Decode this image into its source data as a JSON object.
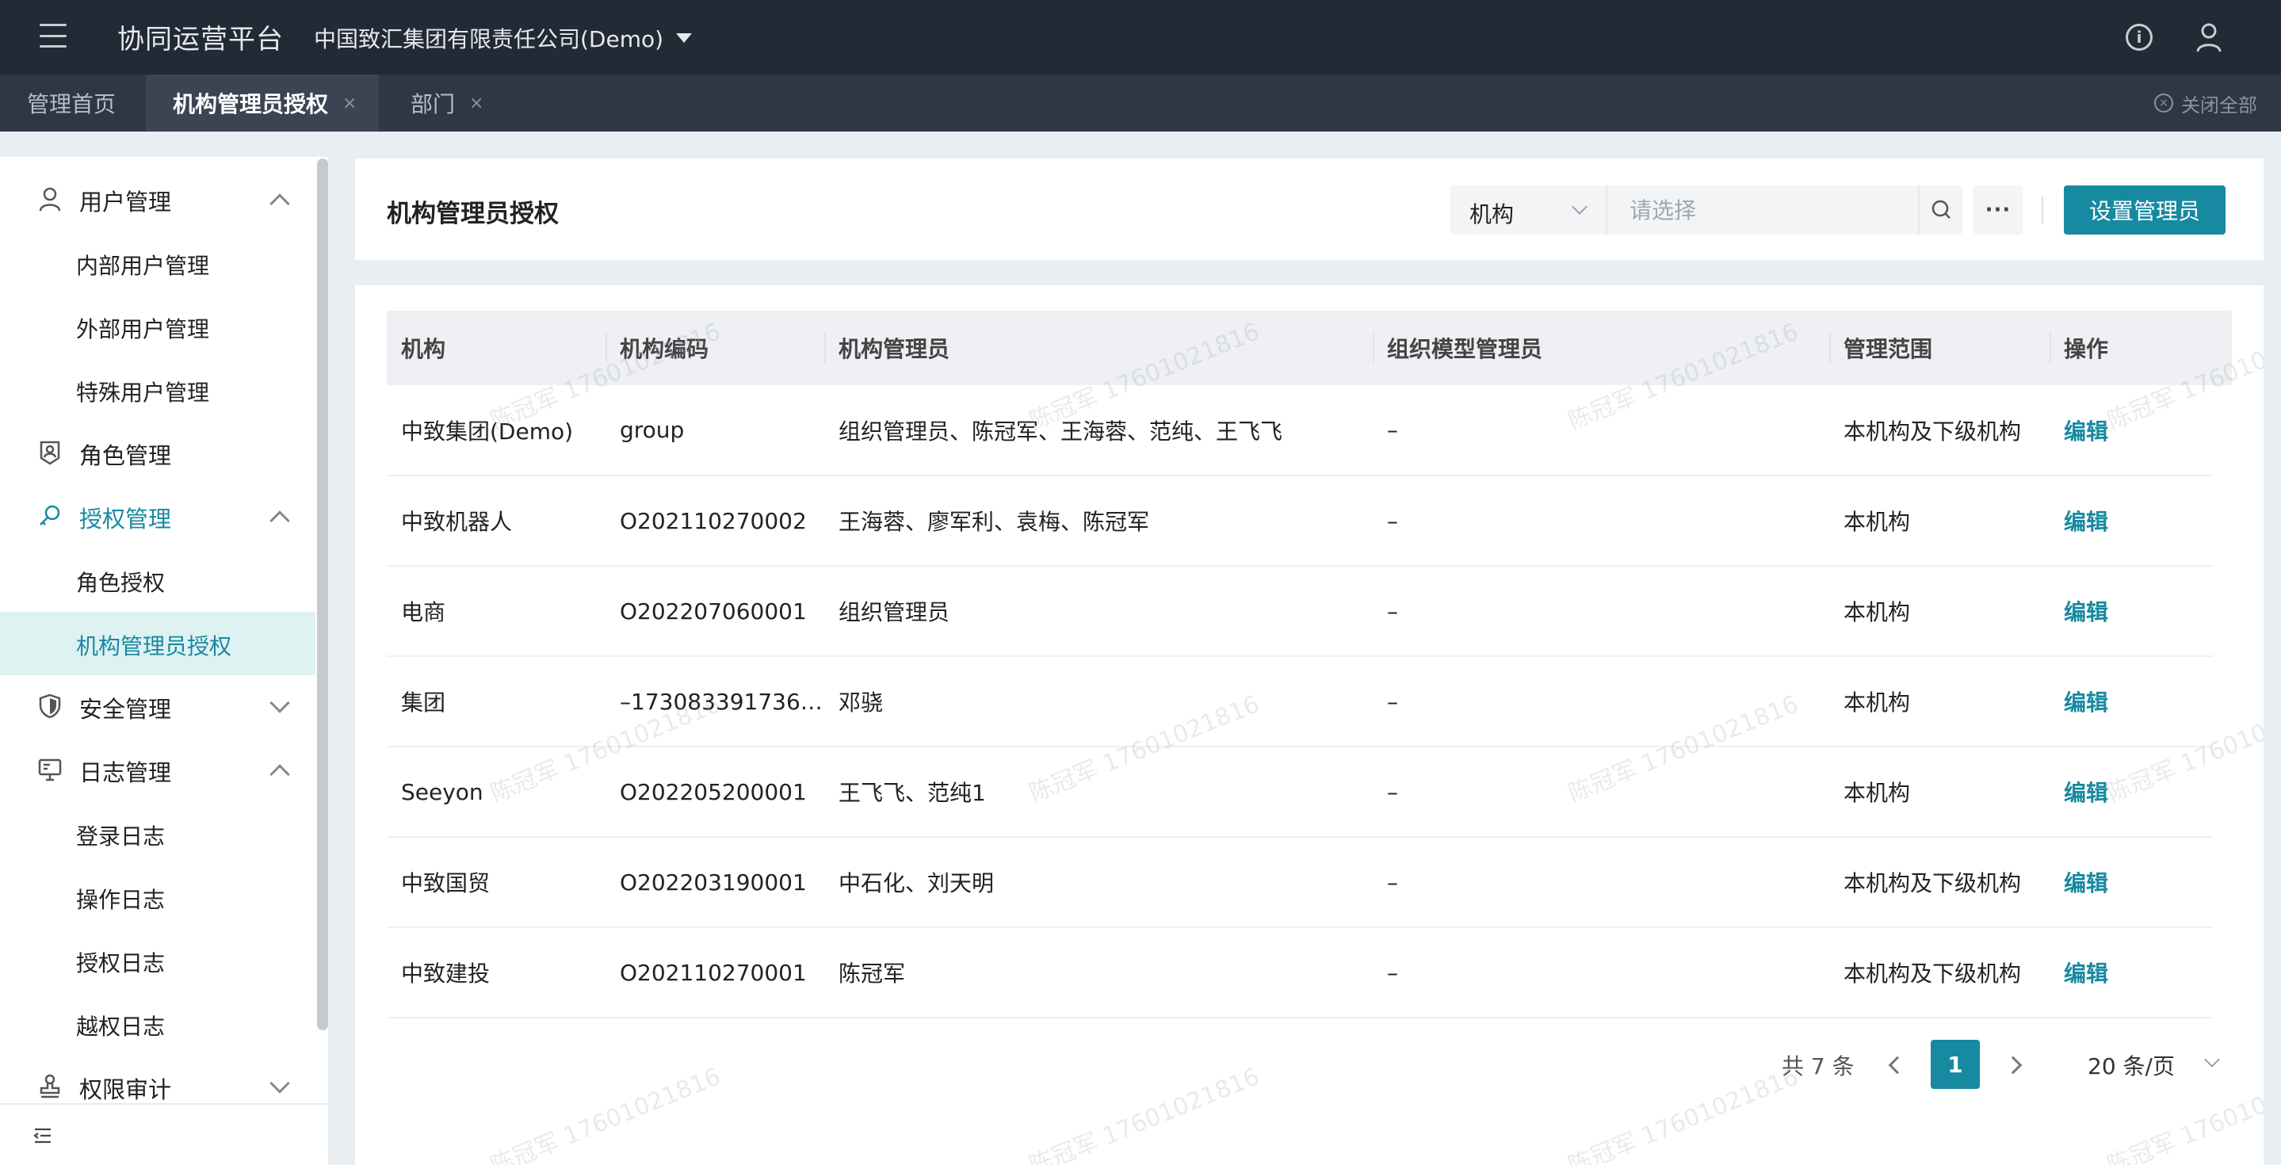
{
  "topbar": {
    "app_title": "协同运营平台",
    "company": "中国致汇集团有限责任公司(Demo)"
  },
  "tabs": [
    {
      "label": "管理首页",
      "active": false,
      "closable": false
    },
    {
      "label": "机构管理员授权",
      "active": true,
      "closable": true
    },
    {
      "label": "部门",
      "active": false,
      "closable": true
    }
  ],
  "tabbar": {
    "close_all": "关闭全部",
    "close_glyph": "×"
  },
  "sidebar": {
    "groups": [
      {
        "label": "用户管理",
        "icon": "user-icon",
        "expanded": true
      },
      {
        "label": "角色管理",
        "icon": "role-icon",
        "expanded": false
      },
      {
        "label": "授权管理",
        "icon": "key-icon",
        "expanded": true,
        "active": true
      },
      {
        "label": "安全管理",
        "icon": "shield-icon",
        "expanded": false
      },
      {
        "label": "日志管理",
        "icon": "monitor-icon",
        "expanded": true
      },
      {
        "label": "权限审计",
        "icon": "stamp-icon",
        "expanded": false
      }
    ],
    "items": {
      "user": [
        "内部用户管理",
        "外部用户管理",
        "特殊用户管理"
      ],
      "auth": [
        "角色授权",
        "机构管理员授权"
      ],
      "log": [
        "登录日志",
        "操作日志",
        "授权日志",
        "越权日志"
      ]
    },
    "selected_item": "机构管理员授权"
  },
  "header": {
    "title": "机构管理员授权",
    "filter_field": "机构",
    "filter_placeholder": "请选择",
    "more_label": "···",
    "primary_button": "设置管理员"
  },
  "table": {
    "columns": [
      "机构",
      "机构编码",
      "机构管理员",
      "组织模型管理员",
      "管理范围",
      "操作"
    ],
    "rows": [
      {
        "org": "中致集团(Demo)",
        "code": "group",
        "admins": "组织管理员、陈冠军、王海蓉、范纯、王飞飞",
        "model_admins": "–",
        "scope": "本机构及下级机构",
        "action": "编辑"
      },
      {
        "org": "中致机器人",
        "code": "O202110270002",
        "admins": "王海蓉、廖军利、袁梅、陈冠军",
        "model_admins": "–",
        "scope": "本机构",
        "action": "编辑"
      },
      {
        "org": "电商",
        "code": "O202207060001",
        "admins": "组织管理员",
        "model_admins": "–",
        "scope": "本机构",
        "action": "编辑"
      },
      {
        "org": "集团",
        "code": "–173083391736…",
        "admins": "邓骁",
        "model_admins": "–",
        "scope": "本机构",
        "action": "编辑"
      },
      {
        "org": "Seeyon",
        "code": "O202205200001",
        "admins": "王飞飞、范纯1",
        "model_admins": "–",
        "scope": "本机构",
        "action": "编辑"
      },
      {
        "org": "中致国贸",
        "code": "O202203190001",
        "admins": "中石化、刘天明",
        "model_admins": "–",
        "scope": "本机构及下级机构",
        "action": "编辑"
      },
      {
        "org": "中致建投",
        "code": "O202110270001",
        "admins": "陈冠军",
        "model_admins": "–",
        "scope": "本机构及下级机构",
        "action": "编辑"
      }
    ]
  },
  "pagination": {
    "total": "共 7 条",
    "current_page": "1",
    "page_size": "20 条/页"
  },
  "watermark": "陈冠军 17601021816",
  "colors": {
    "accent": "#1789a0",
    "topbar": "#222a35",
    "tabbar": "#2e3744",
    "selected_bg": "#dff2f2"
  }
}
